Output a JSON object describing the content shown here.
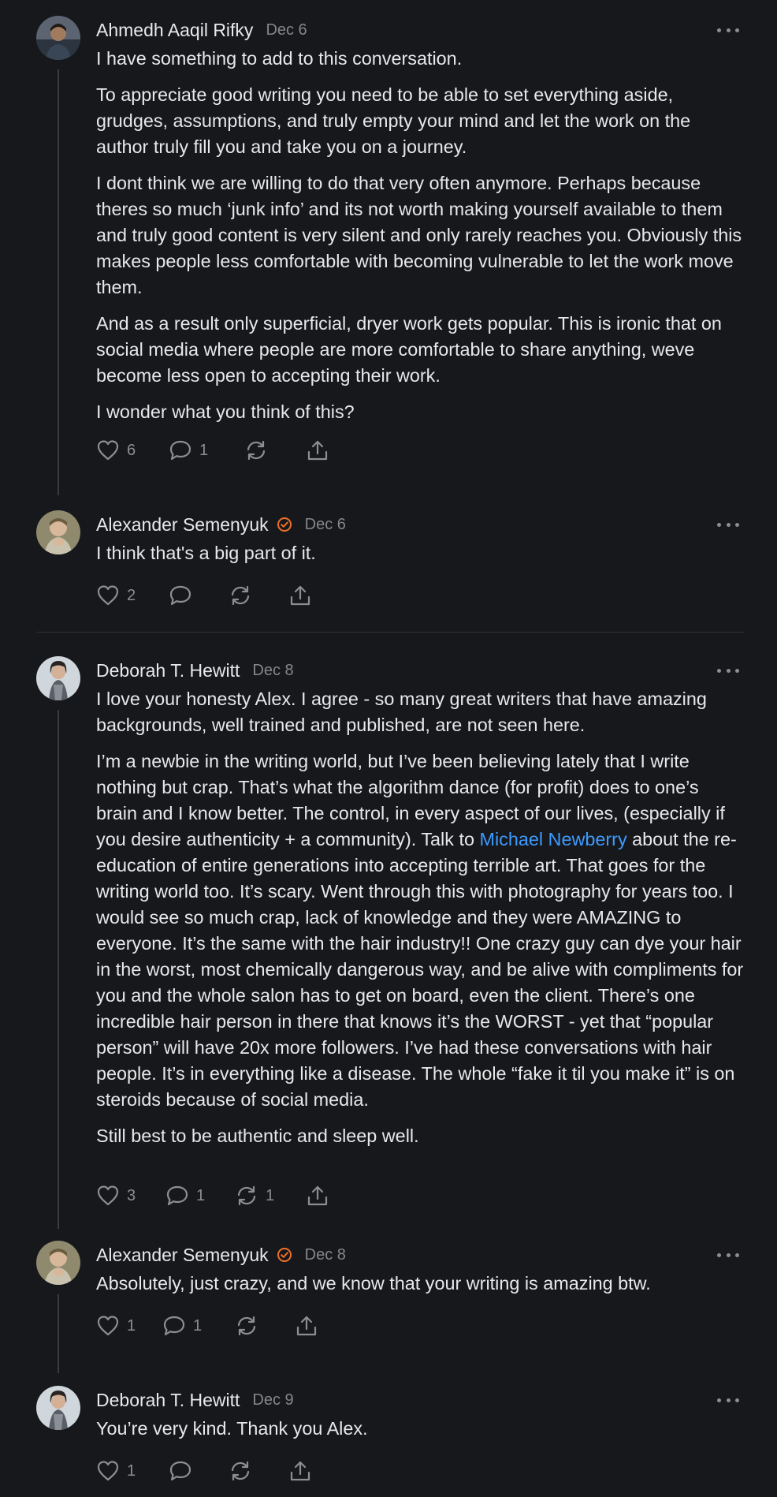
{
  "colors": {
    "background": "#17181b",
    "text": "#e8e8ea",
    "muted": "#86868b",
    "link": "#3d9bff",
    "badge": "#f0702a",
    "thread_line": "#3a3b3f"
  },
  "icons": {
    "like": "heart-icon",
    "reply": "speech-bubble-icon",
    "restack": "restack-arrows-icon",
    "share": "share-upload-icon",
    "more": "ellipsis-icon",
    "verified": "orange-check-circle-icon"
  },
  "comments": [
    {
      "author": "Ahmedh Aaqil Rifky",
      "date": "Dec 6",
      "paragraphs": [
        "I have something to add to this conversation.",
        "To appreciate good writing you need to be able to set everything aside, grudges, assumptions, and truly empty your mind and let the work on the author truly fill you and take you on a journey.",
        "I dont think we are willing to do that very often anymore. Perhaps because theres so much ‘junk info’ and its not worth making yourself available to them and truly good content is very silent and only rarely reaches you. Obviously this makes people less comfortable with becoming vulnerable to let the work move them.",
        "And as a result only superficial, dryer work gets popular. This is ironic that on social media where people are more comfortable to share anything, weve become less open to accepting their work.",
        "I wonder what you think of this?"
      ],
      "likes": "6",
      "replies": "1",
      "restacks": ""
    },
    {
      "author": "Alexander Semenyuk",
      "date": "Dec 6",
      "paragraphs": [
        "I think that's a big part of it."
      ],
      "likes": "2",
      "replies": "",
      "restacks": ""
    },
    {
      "author": "Deborah T. Hewitt",
      "date": "Dec 8",
      "paragraphs": [
        "I love your honesty Alex. I agree - so many great writers that have amazing backgrounds, well trained and published, are not seen here."
      ],
      "paragraph2_before": "I’m a newbie in the writing world, but I’ve been believing lately that I write nothing but crap. That’s what the algorithm dance (for profit) does to one’s brain and I know better. The control, in every aspect of our lives, (especially if you desire authenticity + a community). Talk to ",
      "paragraph2_link": "Michael Newberry",
      "paragraph2_after": " about the re-education of entire generations into accepting terrible art. That goes for the writing world too. It’s scary. Went through this with photography for years too. I would see so much crap, lack of knowledge and they were AMAZING to everyone. It’s the same with the hair industry!! One crazy guy can dye your hair in the worst, most chemically dangerous way, and be alive with compliments for you and the whole salon has to get on board, even the client. There’s one incredible hair person in there that knows it’s the WORST - yet that “popular person” will have 20x more followers. I’ve had these conversations with hair people. It’s in everything like a disease. The whole “fake it til you make it” is on steroids because of social media.",
      "paragraph3": "Still best to be authentic and sleep well.",
      "likes": "3",
      "replies": "1",
      "restacks": "1"
    },
    {
      "author": "Alexander Semenyuk",
      "date": "Dec 8",
      "paragraphs": [
        "Absolutely, just crazy, and we know that your writing is amazing btw."
      ],
      "likes": "1",
      "replies": "1",
      "restacks": ""
    },
    {
      "author": "Deborah T. Hewitt",
      "date": "Dec 9",
      "paragraphs": [
        "You’re very kind. Thank you Alex."
      ],
      "likes": "1",
      "replies": "",
      "restacks": ""
    }
  ]
}
